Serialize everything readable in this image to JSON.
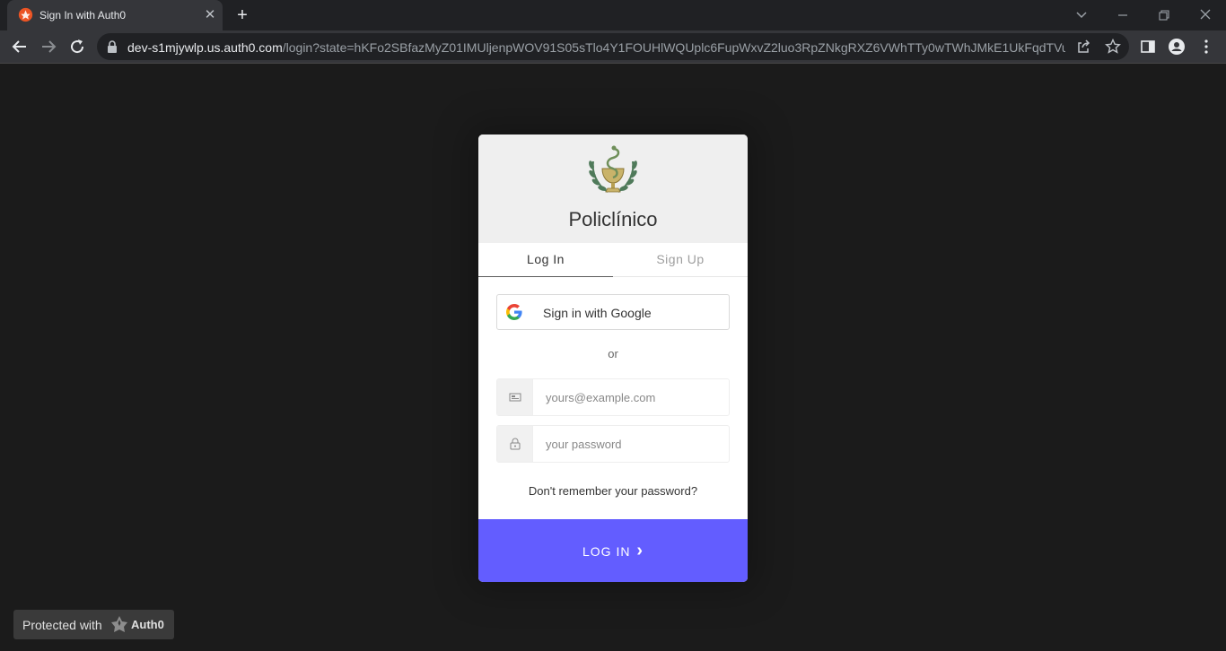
{
  "browser": {
    "tab_title": "Sign In with Auth0",
    "url_host": "dev-s1mjywlp.us.auth0.com",
    "url_rest": "/login?state=hKFo2SBfazMyZ01IMUljenpWOV91S05sTlo4Y1FOUHlWQUplc6FupWxvZ2luo3RpZNkgRXZ6VWhTTy0wTWhJMkE1UkFqdTVuVT..."
  },
  "lock": {
    "app_name": "Policlínico",
    "tabs": [
      "Log In",
      "Sign Up"
    ],
    "google_label": "Sign in with Google",
    "or": "or",
    "email_placeholder": "yours@example.com",
    "password_placeholder": "your password",
    "forgot": "Don't remember your password?",
    "submit": "LOG IN",
    "submit_arrow": "›"
  },
  "badge": {
    "text": "Protected with",
    "brand": "Auth0"
  },
  "colors": {
    "accent": "#635dff",
    "page_bg": "#1b1b1b"
  }
}
